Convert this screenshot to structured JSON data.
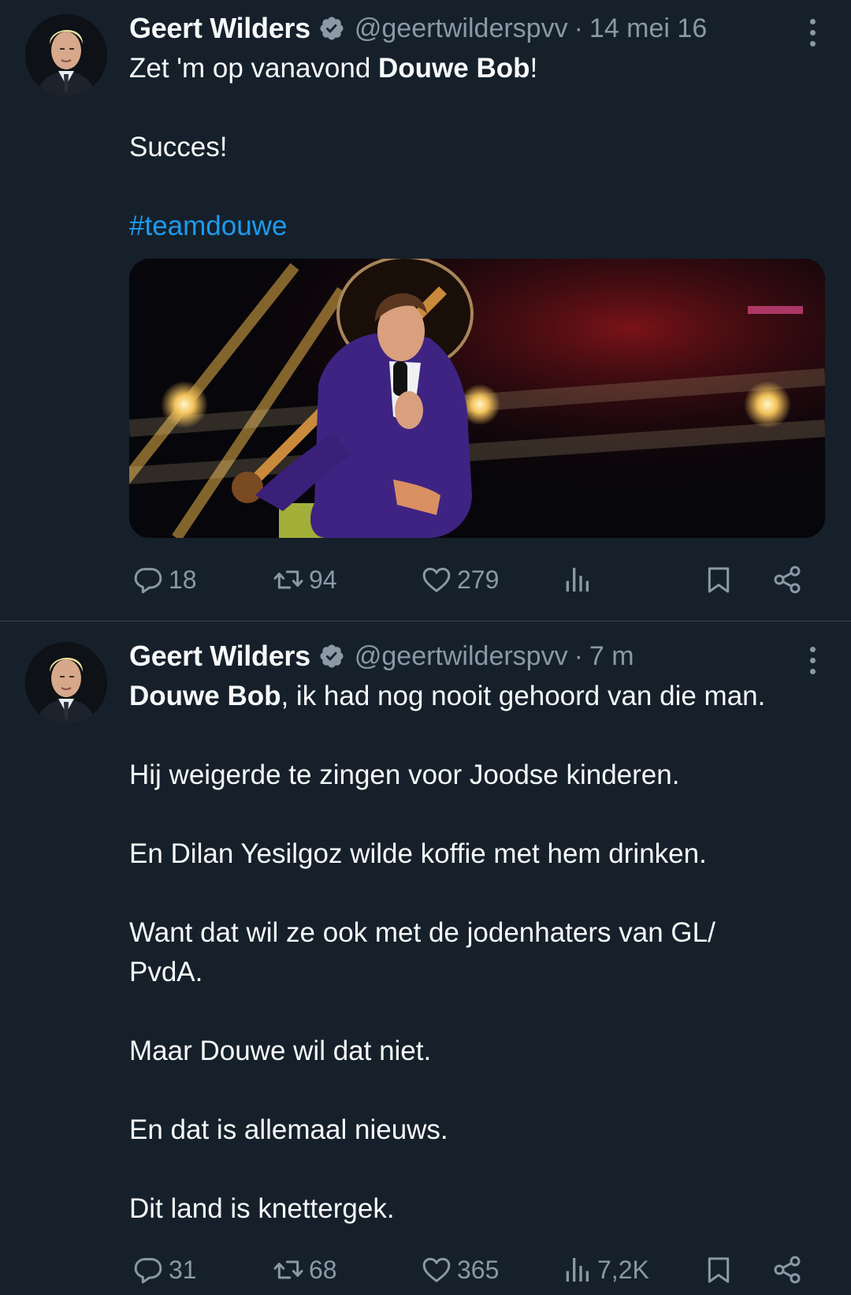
{
  "colors": {
    "background": "#15202b",
    "text": "#f7f9f9",
    "muted": "#8b98a5",
    "link": "#1d9bf0",
    "divider": "#38444d"
  },
  "tweets": [
    {
      "author_name": "Geert Wilders",
      "handle": "@geertwilderspvv",
      "separator": "·",
      "time": "14 mei 16",
      "lines": {
        "l1_pre": "Zet 'm op vanavond ",
        "l1_bold": "Douwe Bob",
        "l1_post": "!",
        "l2": "Succes!",
        "hashtag": "#teamdouwe"
      },
      "has_image": true,
      "replies": "18",
      "retweets": "94",
      "likes": "279",
      "views": ""
    },
    {
      "author_name": "Geert Wilders",
      "handle": "@geertwilderspvv",
      "separator": "·",
      "time": "7 m",
      "lines": {
        "l1_bold": "Douwe Bob",
        "l1_post": ", ik had nog nooit gehoord van die man.",
        "l2": "Hij weigerde te zingen voor Joodse kinderen.",
        "l3": "En Dilan Yesilgoz wilde koffie met hem drinken.",
        "l4a": "Want dat wil ze ook met de jodenhaters van GL/",
        "l4b": "PvdA.",
        "l5": "Maar Douwe wil dat niet.",
        "l6": "En dat is allemaal nieuws.",
        "l7": "Dit land is knettergek."
      },
      "has_image": false,
      "replies": "31",
      "retweets": "68",
      "likes": "365",
      "views": "7,2K"
    }
  ],
  "icons": [
    "verified-badge-icon",
    "more-icon",
    "reply-icon",
    "retweet-icon",
    "like-icon",
    "views-icon",
    "bookmark-icon",
    "share-icon"
  ]
}
